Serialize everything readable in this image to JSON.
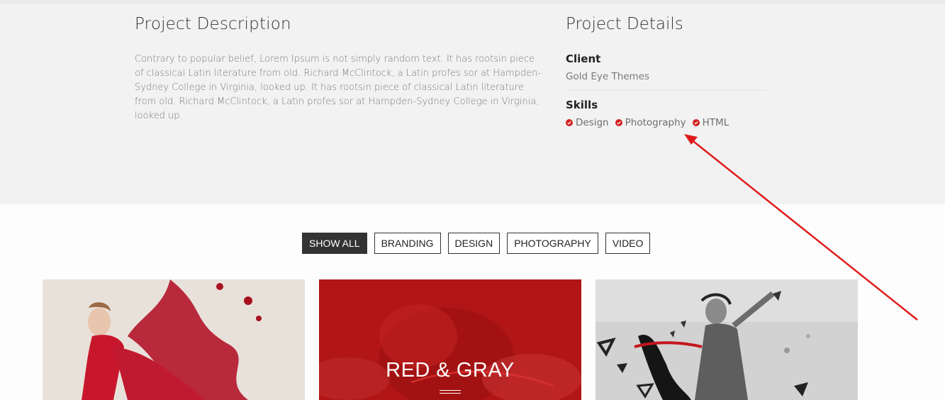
{
  "description": {
    "title": "Project Description",
    "body": "Contrary to popular belief, Lorem Ipsum is not simply random text. It has rootsin piece of classical Latin literature from old. Richard McClintock, a Latin profes sor at Hampden-Sydney College in Virginia, looked up. It has rootsin piece of classical Latin literature from old. Richard McClintock, a Latin profes sor at Hampden-Sydney College in Virginia, looked up."
  },
  "details": {
    "title": "Project Details",
    "client_label": "Client",
    "client_value": "Gold Eye Themes",
    "skills_label": "Skills",
    "skills": [
      "Design",
      "Photography",
      "HTML"
    ]
  },
  "filters": [
    "SHOW ALL",
    "BRANDING",
    "DESIGN",
    "PHOTOGRAPHY",
    "VIDEO"
  ],
  "portfolio": [
    {
      "caption": ""
    },
    {
      "caption": "RED & GRAY"
    },
    {
      "caption": ""
    }
  ],
  "colors": {
    "accent": "#d42020",
    "annotation_arrow": "#e01b1b",
    "band": "#f2f2f2"
  },
  "icons": {
    "skill_marker": "check-circle-icon"
  }
}
